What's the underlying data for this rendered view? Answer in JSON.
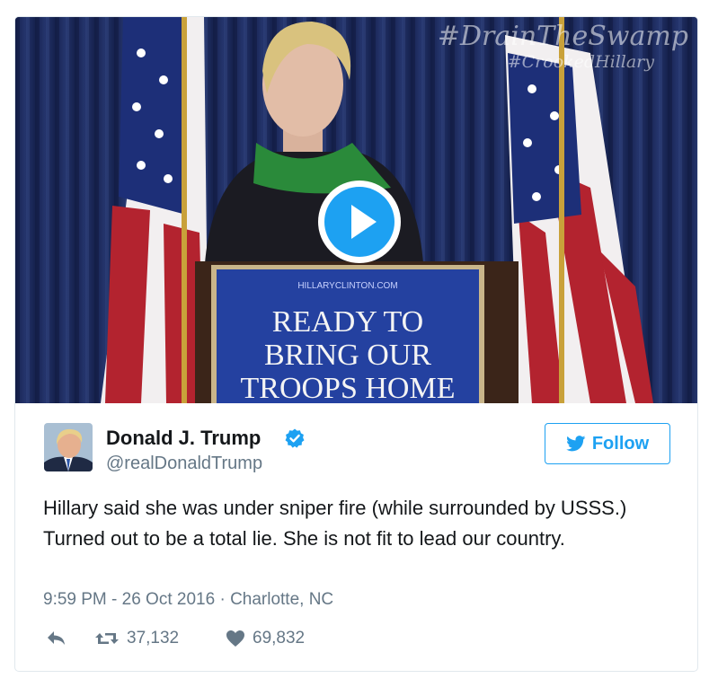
{
  "media": {
    "hashtag_line1": "#DrainTheSwamp",
    "hashtag_line2": "#CrookedHillary",
    "podium_small": "HILLARYCLINTON.COM",
    "podium_line1": "READY TO",
    "podium_line2": "BRING OUR",
    "podium_line3": "TROOPS HOME"
  },
  "author": {
    "name": "Donald J. Trump",
    "handle": "@realDonaldTrump",
    "verified": true
  },
  "follow_label": "Follow",
  "tweet": {
    "text": "Hillary said she was under sniper fire (while surrounded by USSS.) Turned out to be a total lie. She is not fit to lead our country.",
    "timestamp": "9:59 PM - 26 Oct 2016",
    "separator": "·",
    "location": "Charlotte, NC"
  },
  "stats": {
    "retweets": "37,132",
    "likes": "69,832"
  },
  "icons": [
    "play-icon",
    "verified-badge-icon",
    "twitter-bird-icon",
    "reply-icon",
    "retweet-icon",
    "heart-icon"
  ],
  "colors": {
    "accent": "#1da1f2",
    "text": "#14171a",
    "muted": "#657786",
    "border": "#e1e8ed"
  }
}
